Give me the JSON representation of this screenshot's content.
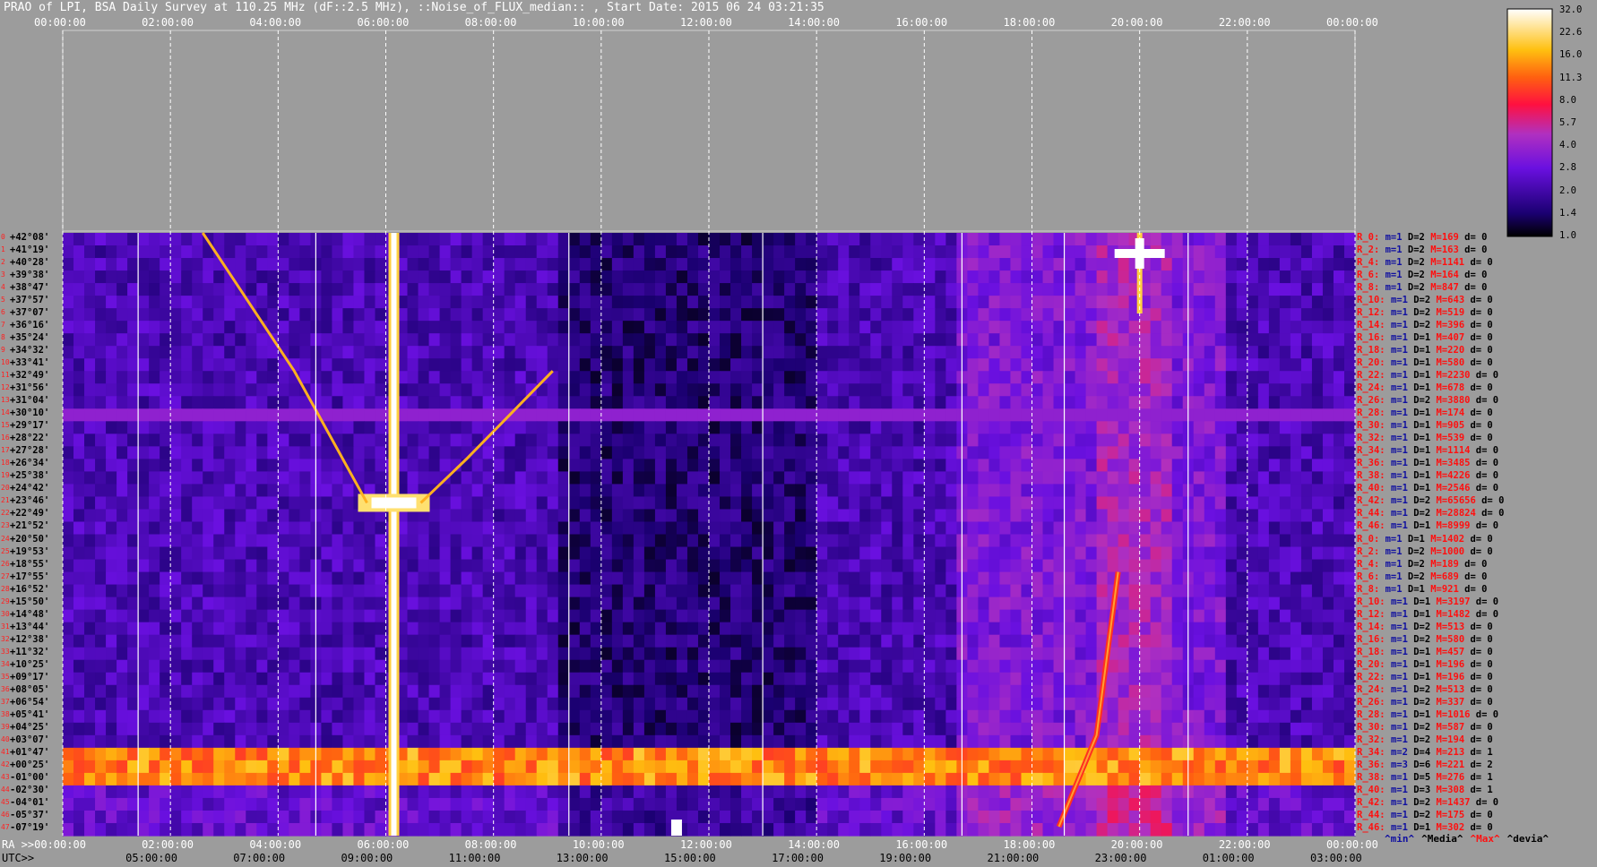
{
  "title": "PRAO of LPI, BSA Daily Survey at 110.25 MHz (dF::2.5 MHz), ::Noise_of_FLUX_median:: , Start Date: 2015 06 24 03:21:35",
  "colors": {
    "background": "#9c9c9c",
    "grid": "#ffffff",
    "row_label": "#ff1010",
    "min_label": "#1010a0"
  },
  "chart_data": {
    "type": "heatmap",
    "title": "PRAO of LPI, BSA Daily Survey at 110.25 MHz (dF::2.5 MHz), ::Noise_of_FLUX_median:: , Start Date: 2015 06 24 03:21:35",
    "x_ra_top": [
      "00:00:00",
      "02:00:00",
      "04:00:00",
      "06:00:00",
      "08:00:00",
      "10:00:00",
      "12:00:00",
      "14:00:00",
      "16:00:00",
      "18:00:00",
      "20:00:00",
      "22:00:00",
      "00:00:00"
    ],
    "x_ra_bottom": [
      "02:00:00",
      "04:00:00",
      "06:00:00",
      "08:00:00",
      "10:00:00",
      "12:00:00",
      "14:00:00",
      "16:00:00",
      "18:00:00",
      "20:00:00",
      "22:00:00",
      "00:00:00"
    ],
    "x_ra_bottom_start": "RA >>00:00:00",
    "x_utc_prefix": "UTC>>",
    "x_utc": [
      "05:00:00",
      "07:00:00",
      "09:00:00",
      "11:00:00",
      "13:00:00",
      "15:00:00",
      "17:00:00",
      "19:00:00",
      "21:00:00",
      "23:00:00",
      "01:00:00",
      "03:00:00"
    ],
    "declinations": [
      "+42°08'",
      "+41°19'",
      "+40°28'",
      "+39°38'",
      "+38°47'",
      "+37°57'",
      "+37°07'",
      "+36°16'",
      "+35°24'",
      "+34°32'",
      "+33°41'",
      "+32°49'",
      "+31°56'",
      "+31°04'",
      "+30°10'",
      "+29°17'",
      "+28°22'",
      "+27°28'",
      "+26°34'",
      "+25°38'",
      "+24°42'",
      "+23°46'",
      "+22°49'",
      "+21°52'",
      "+20°50'",
      "+19°53'",
      "+18°55'",
      "+17°55'",
      "+16°52'",
      "+15°50'",
      "+14°48'",
      "+13°44'",
      "+12°38'",
      "+11°32'",
      "+10°25'",
      "+09°17'",
      "+08°05'",
      "+06°54'",
      "+05°41'",
      "+04°25'",
      "+03°07'",
      "+01°47'",
      "+00°25'",
      "-01°00'",
      "-02°30'",
      "-04°01'",
      "-05°37'",
      "-07°19'"
    ],
    "colorbar": {
      "ticks": [
        "32.0",
        "22.6",
        "16.0",
        "11.3",
        "8.0",
        "5.7",
        "4.0",
        "2.8",
        "2.0",
        "1.4",
        "1.0"
      ],
      "scale": "log"
    },
    "legend": [
      "^min^",
      "^Media^",
      "^Max^",
      "^devia^"
    ],
    "rows": [
      {
        "r": "R_0:",
        "m": "m=1",
        "d": "D=2",
        "mx": "M=169",
        "dv": "d= 0"
      },
      {
        "r": "R_2:",
        "m": "m=1",
        "d": "D=2",
        "mx": "M=163",
        "dv": "d= 0"
      },
      {
        "r": "R_4:",
        "m": "m=1",
        "d": "D=2",
        "mx": "M=1141",
        "dv": "d= 0"
      },
      {
        "r": "R_6:",
        "m": "m=1",
        "d": "D=2",
        "mx": "M=164",
        "dv": "d= 0"
      },
      {
        "r": "R_8:",
        "m": "m=1",
        "d": "D=2",
        "mx": "M=847",
        "dv": "d= 0"
      },
      {
        "r": "R_10:",
        "m": "m=1",
        "d": "D=2",
        "mx": "M=643",
        "dv": "d= 0"
      },
      {
        "r": "R_12:",
        "m": "m=1",
        "d": "D=2",
        "mx": "M=519",
        "dv": "d= 0"
      },
      {
        "r": "R_14:",
        "m": "m=1",
        "d": "D=2",
        "mx": "M=396",
        "dv": "d= 0"
      },
      {
        "r": "R_16:",
        "m": "m=1",
        "d": "D=1",
        "mx": "M=407",
        "dv": "d= 0"
      },
      {
        "r": "R_18:",
        "m": "m=1",
        "d": "D=1",
        "mx": "M=220",
        "dv": "d= 0"
      },
      {
        "r": "R_20:",
        "m": "m=1",
        "d": "D=1",
        "mx": "M=580",
        "dv": "d= 0"
      },
      {
        "r": "R_22:",
        "m": "m=1",
        "d": "D=1",
        "mx": "M=2230",
        "dv": "d= 0"
      },
      {
        "r": "R_24:",
        "m": "m=1",
        "d": "D=1",
        "mx": "M=678",
        "dv": "d= 0"
      },
      {
        "r": "R_26:",
        "m": "m=1",
        "d": "D=2",
        "mx": "M=3880",
        "dv": "d= 0"
      },
      {
        "r": "R_28:",
        "m": "m=1",
        "d": "D=1",
        "mx": "M=174",
        "dv": "d= 0"
      },
      {
        "r": "R_30:",
        "m": "m=1",
        "d": "D=1",
        "mx": "M=905",
        "dv": "d= 0"
      },
      {
        "r": "R_32:",
        "m": "m=1",
        "d": "D=1",
        "mx": "M=539",
        "dv": "d= 0"
      },
      {
        "r": "R_34:",
        "m": "m=1",
        "d": "D=1",
        "mx": "M=1114",
        "dv": "d= 0"
      },
      {
        "r": "R_36:",
        "m": "m=1",
        "d": "D=1",
        "mx": "M=3485",
        "dv": "d= 0"
      },
      {
        "r": "R_38:",
        "m": "m=1",
        "d": "D=1",
        "mx": "M=4226",
        "dv": "d= 0"
      },
      {
        "r": "R_40:",
        "m": "m=1",
        "d": "D=1",
        "mx": "M=2546",
        "dv": "d= 0"
      },
      {
        "r": "R_42:",
        "m": "m=1",
        "d": "D=2",
        "mx": "M=65656",
        "dv": "d= 0"
      },
      {
        "r": "R_44:",
        "m": "m=1",
        "d": "D=2",
        "mx": "M=28824",
        "dv": "d= 0"
      },
      {
        "r": "R_46:",
        "m": "m=1",
        "d": "D=1",
        "mx": "M=8999",
        "dv": "d= 0"
      },
      {
        "r": "R_0:",
        "m": "m=1",
        "d": "D=1",
        "mx": "M=1402",
        "dv": "d= 0"
      },
      {
        "r": "R_2:",
        "m": "m=1",
        "d": "D=2",
        "mx": "M=1000",
        "dv": "d= 0"
      },
      {
        "r": "R_4:",
        "m": "m=1",
        "d": "D=2",
        "mx": "M=189",
        "dv": "d= 0"
      },
      {
        "r": "R_6:",
        "m": "m=1",
        "d": "D=2",
        "mx": "M=689",
        "dv": "d= 0"
      },
      {
        "r": "R_8:",
        "m": "m=1",
        "d": "D=1",
        "mx": "M=921",
        "dv": "d= 0"
      },
      {
        "r": "R_10:",
        "m": "m=1",
        "d": "D=1",
        "mx": "M=3197",
        "dv": "d= 0"
      },
      {
        "r": "R_12:",
        "m": "m=1",
        "d": "D=1",
        "mx": "M=1482",
        "dv": "d= 0"
      },
      {
        "r": "R_14:",
        "m": "m=1",
        "d": "D=2",
        "mx": "M=513",
        "dv": "d= 0"
      },
      {
        "r": "R_16:",
        "m": "m=1",
        "d": "D=2",
        "mx": "M=580",
        "dv": "d= 0"
      },
      {
        "r": "R_18:",
        "m": "m=1",
        "d": "D=1",
        "mx": "M=457",
        "dv": "d= 0"
      },
      {
        "r": "R_20:",
        "m": "m=1",
        "d": "D=1",
        "mx": "M=196",
        "dv": "d= 0"
      },
      {
        "r": "R_22:",
        "m": "m=1",
        "d": "D=1",
        "mx": "M=196",
        "dv": "d= 0"
      },
      {
        "r": "R_24:",
        "m": "m=1",
        "d": "D=2",
        "mx": "M=513",
        "dv": "d= 0"
      },
      {
        "r": "R_26:",
        "m": "m=1",
        "d": "D=2",
        "mx": "M=337",
        "dv": "d= 0"
      },
      {
        "r": "R_28:",
        "m": "m=1",
        "d": "D=1",
        "mx": "M=1016",
        "dv": "d= 0"
      },
      {
        "r": "R_30:",
        "m": "m=1",
        "d": "D=2",
        "mx": "M=587",
        "dv": "d= 0"
      },
      {
        "r": "R_32:",
        "m": "m=1",
        "d": "D=2",
        "mx": "M=194",
        "dv": "d= 0"
      },
      {
        "r": "R_34:",
        "m": "m=2",
        "d": "D=4",
        "mx": "M=213",
        "dv": "d= 1"
      },
      {
        "r": "R_36:",
        "m": "m=3",
        "d": "D=6",
        "mx": "M=221",
        "dv": "d= 2"
      },
      {
        "r": "R_38:",
        "m": "m=1",
        "d": "D=5",
        "mx": "M=276",
        "dv": "d= 1"
      },
      {
        "r": "R_40:",
        "m": "m=1",
        "d": "D=3",
        "mx": "M=308",
        "dv": "d= 1"
      },
      {
        "r": "R_42:",
        "m": "m=1",
        "d": "D=2",
        "mx": "M=1437",
        "dv": "d= 0"
      },
      {
        "r": "R_44:",
        "m": "m=1",
        "d": "D=2",
        "mx": "M=175",
        "dv": "d= 0"
      },
      {
        "r": "R_46:",
        "m": "m=1",
        "d": "D=1",
        "mx": "M=302",
        "dv": "d= 0"
      }
    ]
  }
}
